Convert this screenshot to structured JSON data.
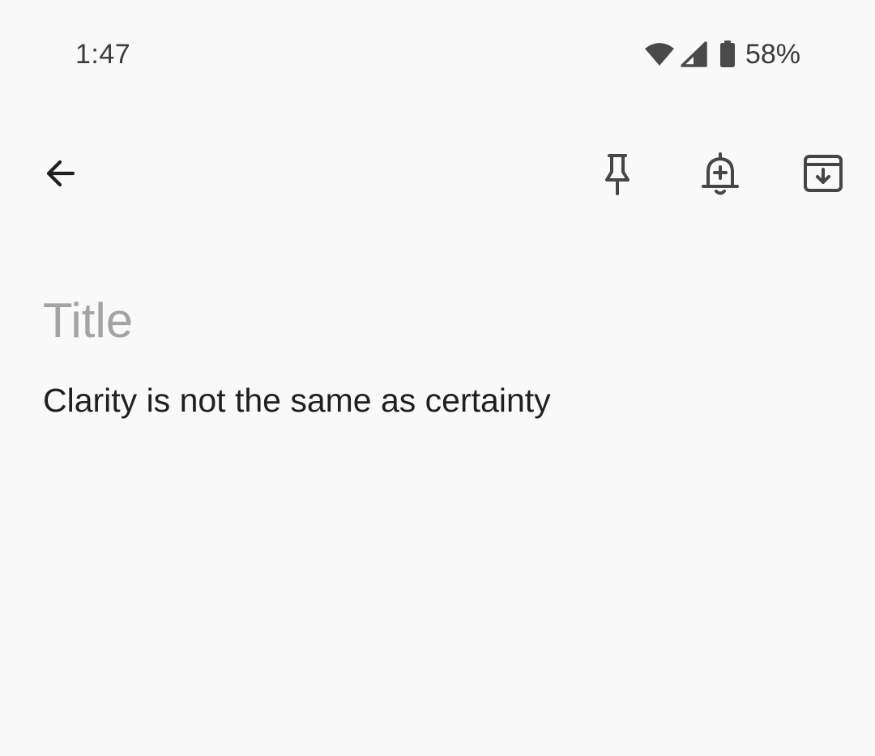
{
  "status_bar": {
    "time": "1:47",
    "battery_percent": "58%",
    "battery_level": 0.58,
    "icons": [
      "wifi-icon",
      "cell-signal-icon",
      "battery-icon"
    ]
  },
  "toolbar": {
    "back_icon": "arrow-left-icon",
    "actions": [
      "pin-icon",
      "add-reminder-bell-icon",
      "archive-icon"
    ]
  },
  "note": {
    "title_value": "",
    "title_placeholder": "Title",
    "body": "Clarity is not the same as certainty"
  },
  "colors": {
    "background": "#f9f9f9",
    "text": "#1f1f1f",
    "placeholder": "#a3a3a3",
    "icon": "#444746"
  }
}
